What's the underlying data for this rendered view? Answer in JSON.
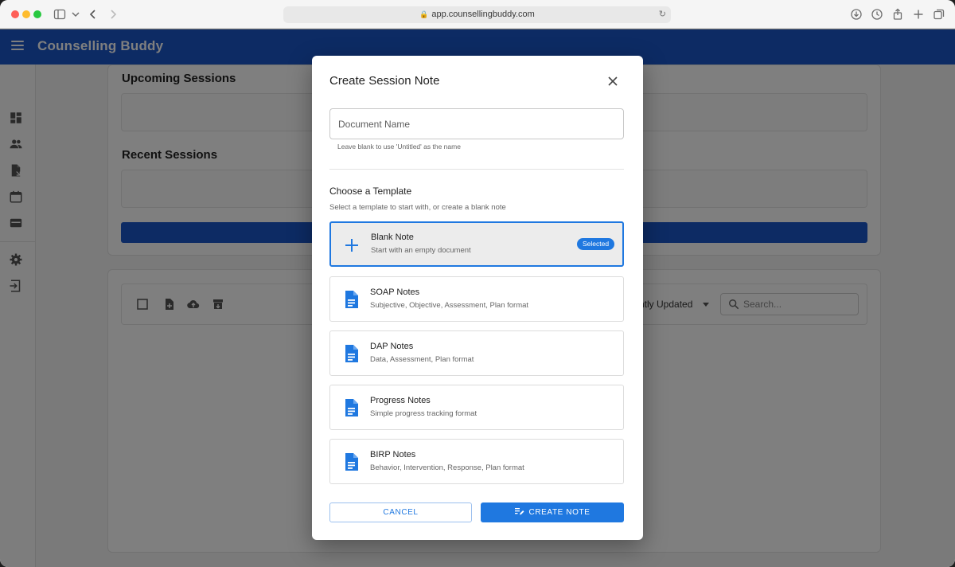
{
  "browser": {
    "url": "app.counsellingbuddy.com"
  },
  "app": {
    "brand": "Counselling Buddy"
  },
  "main": {
    "upcoming_title": "Upcoming Sessions",
    "recent_title": "Recent Sessions",
    "sort_label": "ntly Updated",
    "search_placeholder": "Search..."
  },
  "modal": {
    "title": "Create Session Note",
    "doc_name_placeholder": "Document Name",
    "doc_name_value": "",
    "helper": "Leave blank to use 'Untitled' as the name",
    "choose_title": "Choose a Template",
    "choose_subtitle": "Select a template to start with, or create a blank note",
    "selected_badge": "Selected",
    "templates": [
      {
        "name": "Blank Note",
        "description": "Start with an empty document",
        "icon": "plus-icon",
        "selected": true
      },
      {
        "name": "SOAP Notes",
        "description": "Subjective, Objective, Assessment, Plan format",
        "icon": "document-icon",
        "selected": false
      },
      {
        "name": "DAP Notes",
        "description": "Data, Assessment, Plan format",
        "icon": "document-icon",
        "selected": false
      },
      {
        "name": "Progress Notes",
        "description": "Simple progress tracking format",
        "icon": "document-icon",
        "selected": false
      },
      {
        "name": "BIRP Notes",
        "description": "Behavior, Intervention, Response, Plan format",
        "icon": "document-icon",
        "selected": false
      }
    ],
    "cancel_label": "CANCEL",
    "create_label": "CREATE NOTE"
  },
  "colors": {
    "primary": "#1f78e0",
    "appbar": "#1a56c9"
  }
}
